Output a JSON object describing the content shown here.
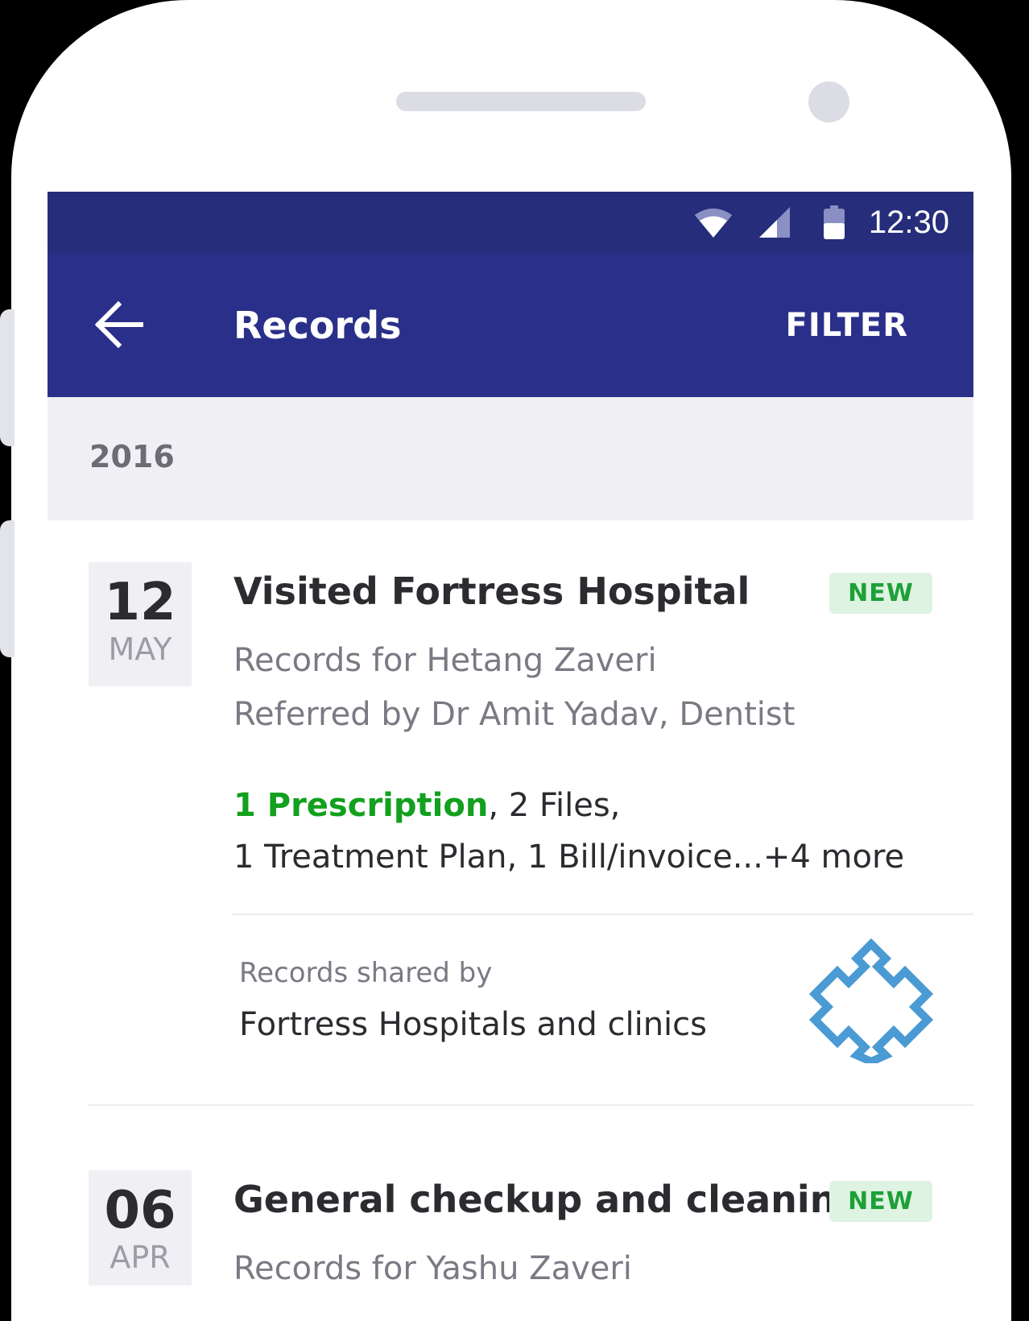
{
  "status_bar": {
    "time": "12:30",
    "icons": [
      "wifi-icon",
      "cell-signal-icon",
      "battery-icon"
    ]
  },
  "app_bar": {
    "title": "Records",
    "filter_label": "FILTER",
    "back_icon": "arrow-left-icon"
  },
  "section": {
    "year": "2016"
  },
  "records": [
    {
      "day": "12",
      "month": "MAY",
      "title": "Visited Fortress Hospital",
      "badge": "NEW",
      "patient_line": "Records for Hetang Zaveri",
      "referral_line": "Referred by Dr Amit Yadav, Dentist",
      "prescription": "1 Prescription",
      "files_text": ", 2 Files,",
      "items_line2": "1 Treatment Plan, 1 Bill/invoice...",
      "more": "+4 more",
      "shared_label": "Records shared by",
      "shared_org": "Fortress Hospitals and clinics",
      "logo_icon": "fortress-cross-logo"
    },
    {
      "day": "06",
      "month": "APR",
      "title": "General checkup and cleaning",
      "badge": "NEW",
      "patient_line": "Records for Yashu Zaveri"
    }
  ],
  "colors": {
    "status_bar": "#262d7b",
    "app_bar": "#2a3089",
    "accent_green": "#12a01e",
    "badge_bg": "#dff3e2",
    "logo_blue": "#4a9ad4"
  }
}
